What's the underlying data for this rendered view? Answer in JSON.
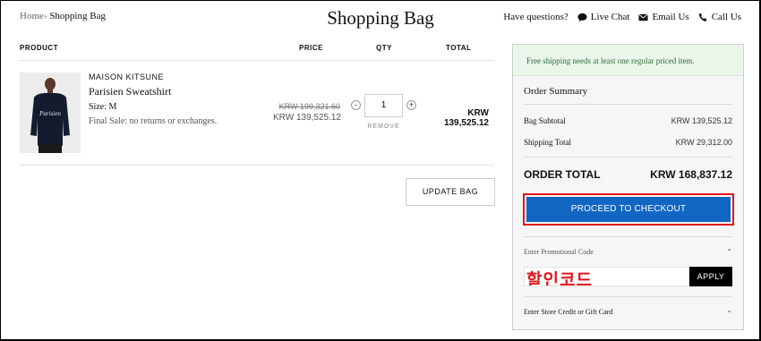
{
  "breadcrumb": {
    "home": "Home",
    "separator": "›",
    "current": "Shopping Bag"
  },
  "page_title": "Shopping Bag",
  "help": {
    "question": "Have questions?",
    "live_chat": "Live Chat",
    "email": "Email Us",
    "call": "Call Us",
    "icons": [
      "chat-bubble-icon",
      "envelope-icon",
      "phone-icon"
    ]
  },
  "table": {
    "headers": {
      "product": "PRODUCT",
      "price": "PRICE",
      "qty": "QTY",
      "total": "TOTAL"
    }
  },
  "item": {
    "brand": "MAISON KITSUNE",
    "name": "Parisien Sweatshirt",
    "size": "Size: M",
    "note": "Final Sale: no returns or exchanges.",
    "price_original": "KRW 199,321.60",
    "price_sale": "KRW 139,525.12",
    "qty_minus": "-",
    "qty_plus": "+",
    "quantity": "1",
    "remove": "REMOVE",
    "total": "KRW 139,525.12",
    "image_text": "Parisien"
  },
  "update_bag": "UPDATE BAG",
  "summary": {
    "notice": "Free shipping needs at least one regular priced item.",
    "title": "Order Summary",
    "bag_subtotal_label": "Bag Subtotal",
    "bag_subtotal": "KRW 139,525.12",
    "shipping_label": "Shipping Total",
    "shipping": "KRW 29,312.00",
    "order_total_label": "ORDER TOTAL",
    "order_total": "KRW 168,837.12",
    "checkout": "PROCEED TO CHECKOUT",
    "promo_label": "Enter Promotional Code",
    "promo_caret": "⌃",
    "promo_value": "할인코드",
    "apply": "APPLY",
    "credit_label": "Enter Store Credit or Gift Card",
    "credit_caret": "⌄"
  },
  "colors": {
    "checkout_bg": "#1166c4",
    "highlight_border": "#e2151d",
    "notice_bg": "#eaf6ea",
    "notice_text": "#2e6b3a"
  }
}
